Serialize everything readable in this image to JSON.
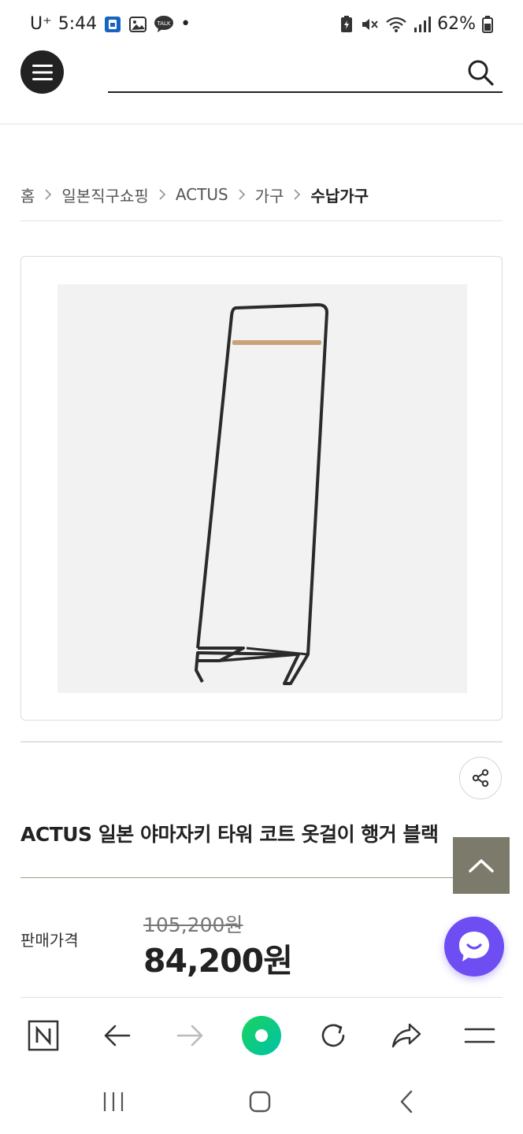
{
  "status_bar": {
    "carrier": "U⁺",
    "time": "5:44",
    "dot": "•",
    "battery": "62%"
  },
  "header": {
    "search_placeholder": ""
  },
  "breadcrumb": {
    "items": [
      "홈",
      "일본직구쇼핑",
      "ACTUS",
      "가구"
    ],
    "current": "수납가구"
  },
  "product": {
    "title": "ACTUS 일본 야마자키 타워 코트 옷걸이 행거 블랙",
    "price_label": "판매가격",
    "original_price": "105,200원",
    "sale_price": "84,200원"
  },
  "colors": {
    "accent_chat": "#6e4ef2",
    "top_button": "#7c7b6b",
    "browser_green": "#19d35e"
  },
  "icons": {
    "menu": "hamburger-icon",
    "search": "search-icon",
    "share": "share-icon",
    "top": "chevron-up-icon",
    "chat": "chat-icon"
  }
}
